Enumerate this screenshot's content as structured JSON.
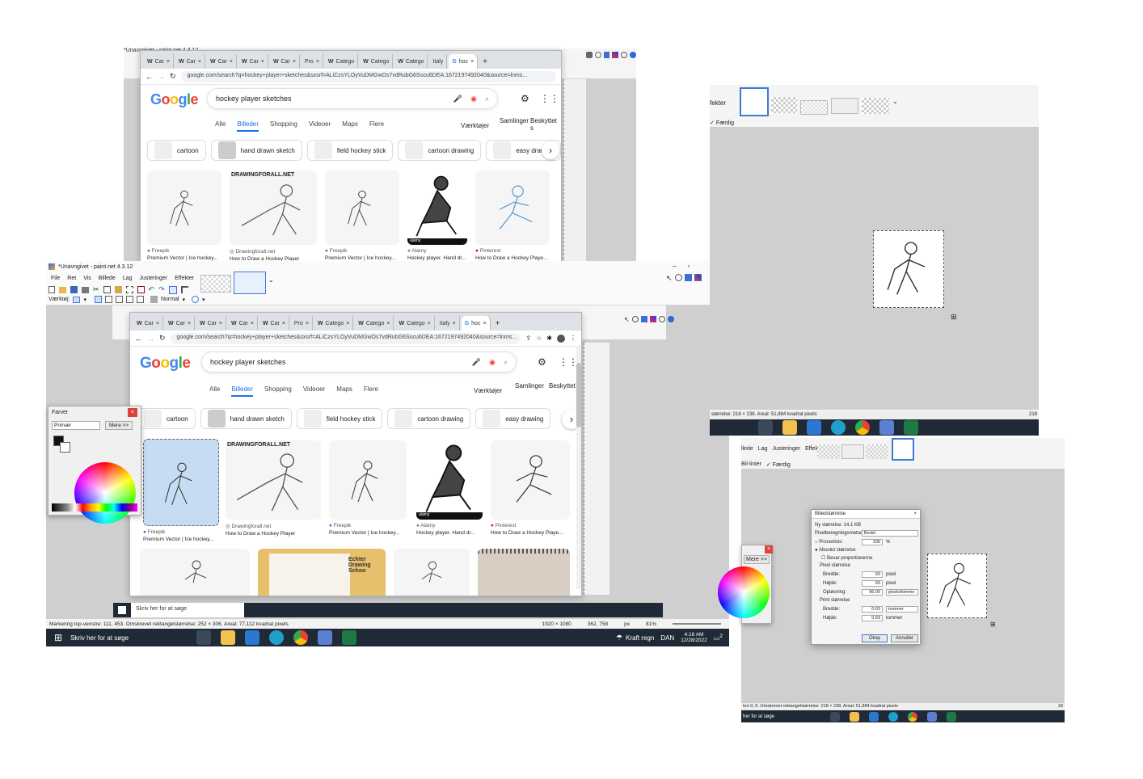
{
  "window1": {
    "title": "*Unavngivet - paint.net 4.3.12",
    "menu": [
      "File",
      "Ret",
      "Vis",
      "Billede",
      "Lag",
      "Justeringer",
      "Effekter"
    ],
    "toolbar_label": "Værktøj:",
    "blend_mode": "Normal",
    "status": "Markering top-venstre: 111, 453. Omskrevet rektangelstørrelse: 252 × 306. Areal: 77,112 kvadrat pixels",
    "status_size": "1920 × 1080",
    "status_pos": "362, 758",
    "units": "px",
    "zoom": "81%"
  },
  "browser": {
    "tabs": [
      "Car",
      "Car",
      "Car",
      "Car",
      "Car",
      "Pro",
      "Catego",
      "Catego",
      "Catego",
      "Italy",
      "hoc"
    ],
    "url": "google.com/search?q=hockey+player+sketches&sxsrf=ALiCzsYLOyVuDMGwOs7vdRubG6Socu6DEA:1672197492040&source=lnms...",
    "search_query": "hockey player sketches",
    "nav_tabs": [
      "Alle",
      "Billeder",
      "Shopping",
      "Videoer",
      "Maps",
      "Flere"
    ],
    "tools_label": "Værktøjer",
    "saved_label": "Samlinger",
    "safe_label": "Beskyttet s",
    "chips": [
      "cartoon",
      "hand drawn sketch",
      "field hockey stick",
      "cartoon drawing",
      "easy drawing"
    ],
    "results": [
      {
        "source": "Freepik",
        "title": "Premium Vector | Ice hockey..."
      },
      {
        "source": "Drawingforall.net",
        "title": "How to Draw a Hockey Player"
      },
      {
        "source": "Freepik",
        "title": "Premium Vector | Ice hockey..."
      },
      {
        "source": "Alamy",
        "title": "Hockey player. Hand dr..."
      },
      {
        "source": "Pinterest",
        "title": "How to Draw a Hockey Playe..."
      }
    ],
    "drawingforall_label": "DRAWINGFORALL.NET",
    "alamy_label": "alamy",
    "echter_label": "Echter Drawing Schoo"
  },
  "farver": {
    "title": "Farver",
    "primary": "Primær",
    "more": "Mere >>"
  },
  "taskbar": {
    "search_placeholder": "Skriv her for at søge",
    "weather": "Kraft regn",
    "lang": "DAN",
    "time": "4:18 AM",
    "date": "12/28/2022",
    "notif": "2"
  },
  "window2": {
    "tabs_label": "fekter",
    "done": "Færdig",
    "status": "størrelse: 218 × 238. Areal: 51,884 kvadrat pixels",
    "status_right": "218"
  },
  "window3": {
    "menu": [
      "llede",
      "Lag",
      "Justeringer",
      "Effekter"
    ],
    "tool_label": "Bil-linier",
    "done": "Færdig",
    "more": "Mere >>",
    "status": "ten 0, 0. Omskrevet rektangelstørrelse: 218 × 238. Areal: 51,884 kvadrat pixels",
    "status_right": "18",
    "taskbar_search": "her for at søge"
  },
  "dialog": {
    "title": "Billedstørrelse",
    "new_size": "Ny størrelse: 14.1 KB",
    "resample_label": "Pixelberegningsmetode:",
    "resample_value": "Bedst",
    "percent_label": "Procentvis:",
    "percent_value": "100",
    "percent_unit": "%",
    "absolute_label": "Absolut størrelse:",
    "keep_ratio": "Bevar proportionerne",
    "pixel_size": "Pixel størrelse",
    "width_label": "Bredde:",
    "width_value": "60",
    "height_label": "Højde:",
    "height_value": "60",
    "px_unit": "pixel",
    "resolution_label": "Opløsning:",
    "resolution_value": "96.00",
    "resolution_unit": "pixels/tomme",
    "print_size": "Print størrelse",
    "print_w_label": "Bredde:",
    "print_w_value": "0.63",
    "print_h_label": "Højde:",
    "print_h_value": "0.63",
    "inch_unit": "tommer",
    "ok": "Okay",
    "cancel": "Annuller"
  }
}
